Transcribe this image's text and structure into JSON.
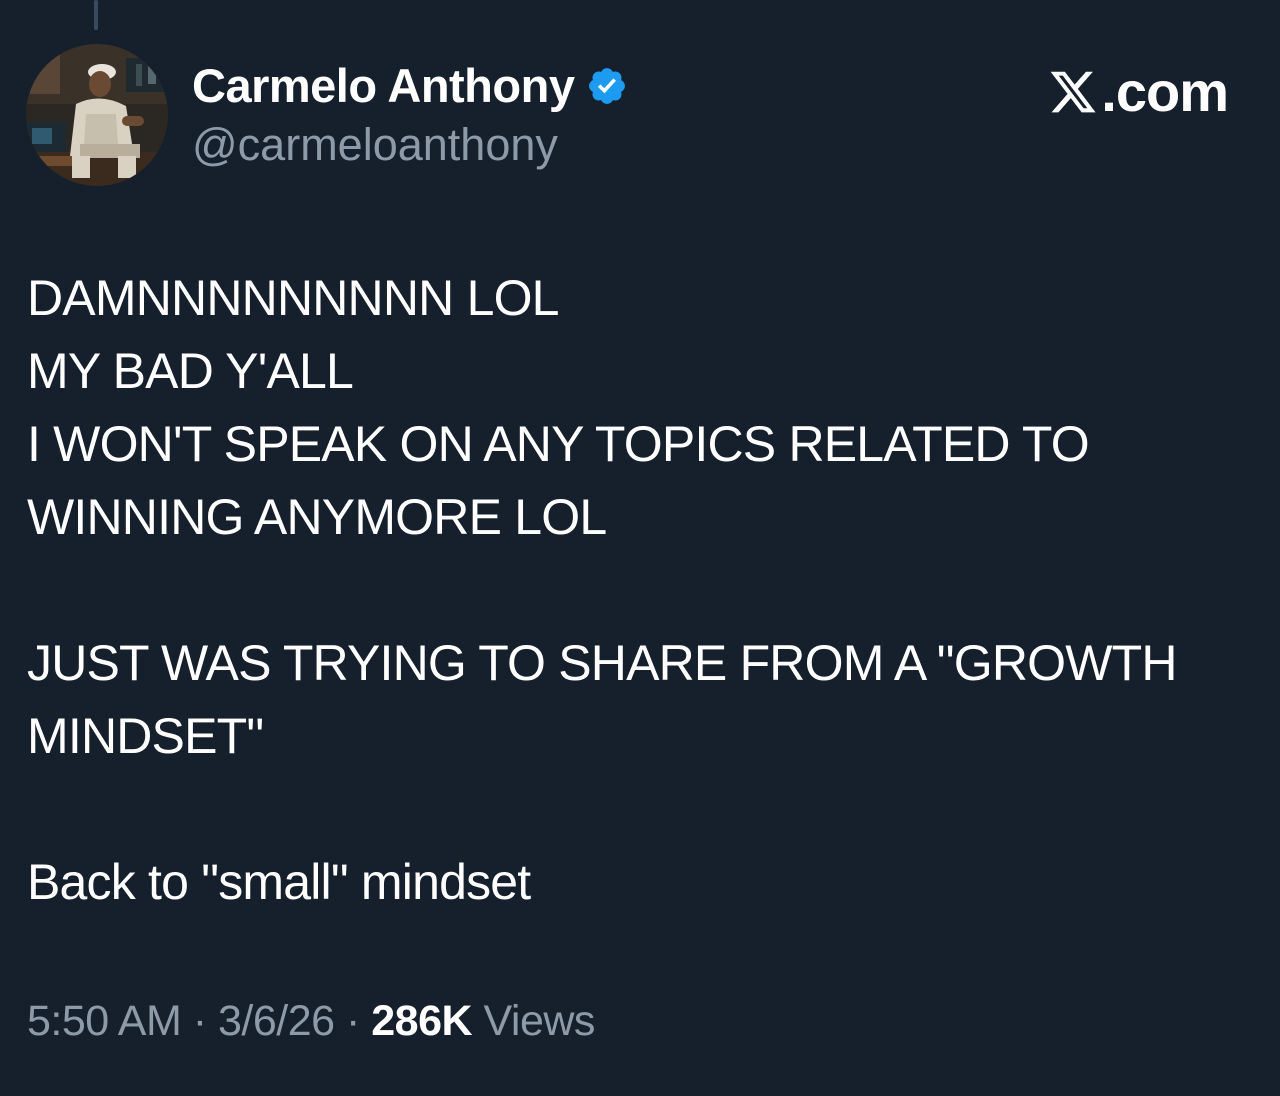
{
  "author": {
    "display_name": "Carmelo Anthony",
    "handle": "@carmeloanthony",
    "verified": true,
    "avatar_icon": "profile-photo"
  },
  "brand": {
    "icon": "x-logo-icon",
    "text": ".com"
  },
  "tweet": {
    "lines": [
      "DAMNNNNNNNNN LOL",
      "MY BAD Y'ALL",
      "I WON'T SPEAK ON ANY TOPICS RELATED TO",
      "WINNING ANYMORE LOL",
      "",
      "JUST WAS TRYING TO SHARE FROM A \"GROWTH",
      "MINDSET\"",
      "",
      "Back to \"small\" mindset"
    ]
  },
  "meta": {
    "time": "5:50 AM",
    "separator": " · ",
    "date": "3/6/26",
    "views_count": "286K",
    "views_label": " Views"
  },
  "colors": {
    "background": "#16202c",
    "text": "#ffffff",
    "muted": "#8d9aa8",
    "verified_badge": "#1d9bf0"
  }
}
